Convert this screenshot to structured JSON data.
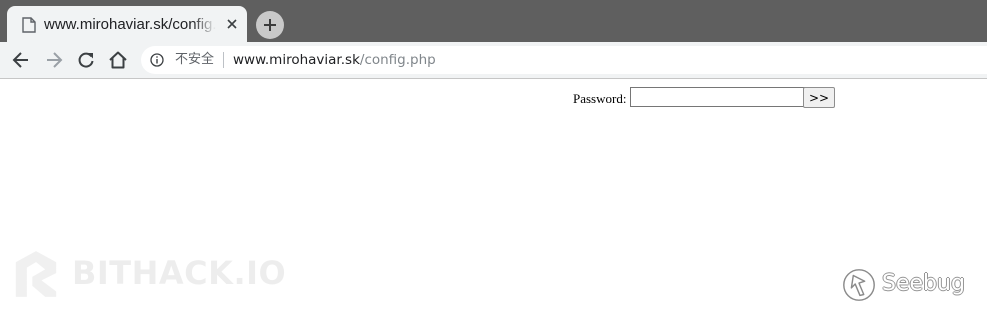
{
  "tab": {
    "title": "www.mirohaviar.sk/config.php",
    "favicon": "page-icon",
    "close_icon": "close-icon"
  },
  "toolbar": {
    "back_icon": "arrow-left-icon",
    "forward_icon": "arrow-right-icon",
    "reload_icon": "reload-icon",
    "home_icon": "home-icon"
  },
  "address_bar": {
    "security_label": "不安全",
    "url_host": "www.mirohaviar.sk",
    "url_path": "/config.php"
  },
  "form": {
    "password_label": "Password:",
    "password_value": "",
    "submit_label": ">>"
  },
  "watermarks": {
    "bithack": "BITHACK.IO",
    "seebug": "Seebug"
  },
  "colors": {
    "tabstrip": "#5f5f5f",
    "toolbar": "#f1f3f4",
    "url_host": "#202124",
    "url_path": "#80868b"
  }
}
